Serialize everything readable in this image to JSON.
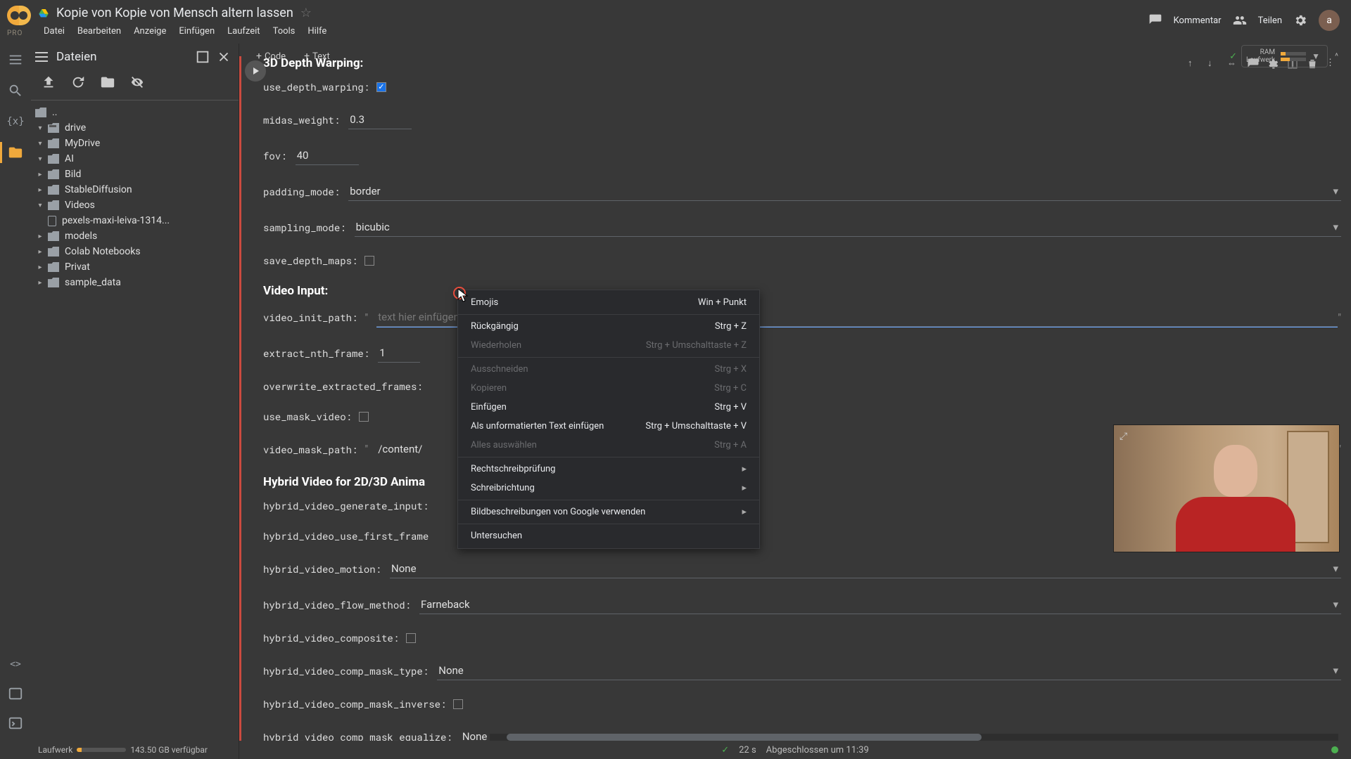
{
  "header": {
    "title": "Kopie von Kopie von Mensch altern lassen",
    "pro": "PRO",
    "menu": [
      "Datei",
      "Bearbeiten",
      "Anzeige",
      "Einfügen",
      "Laufzeit",
      "Tools",
      "Hilfe"
    ],
    "kommentar": "Kommentar",
    "teilen": "Teilen",
    "avatar": "a",
    "ram_l1": "RAM",
    "ram_l2": "Laufwerk"
  },
  "sub": {
    "code": "Code",
    "text": "Text"
  },
  "files": {
    "title": "Dateien",
    "tree": {
      "up": "..",
      "drive": "drive",
      "mydrive": "MyDrive",
      "ai": "AI",
      "bild": "Bild",
      "sd": "StableDiffusion",
      "videos": "Videos",
      "vidfile": "pexels-maxi-leiva-1314...",
      "models": "models",
      "colab": "Colab Notebooks",
      "privat": "Privat",
      "sample": "sample_data"
    },
    "disk_label": "Laufwerk",
    "disk_free": "143.50 GB verfügbar"
  },
  "form": {
    "sec1": "3D Depth Warping:",
    "use_depth_warping": "use_depth_warping:",
    "midas_weight_l": "midas_weight:",
    "midas_weight": "0.3",
    "fov_l": "fov:",
    "fov": "40",
    "padding_mode_l": "padding_mode:",
    "padding_mode": "border",
    "sampling_mode_l": "sampling_mode:",
    "sampling_mode": "bicubic",
    "save_depth_maps_l": "save_depth_maps:",
    "sec2": "Video Input:",
    "video_init_path_l": "video_init_path:",
    "video_init_path_ph": "text hier einfügen",
    "extract_nth_frame_l": "extract_nth_frame:",
    "extract_nth_frame": "1",
    "overwrite_extracted_frames_l": "overwrite_extracted_frames:",
    "use_mask_video_l": "use_mask_video:",
    "video_mask_path_l": "video_mask_path:",
    "video_mask_path": "/content/",
    "sec3": "Hybrid Video for 2D/3D Anima",
    "hybrid_video_generate_input_l": "hybrid_video_generate_input:",
    "hybrid_video_use_first_frame_l": "hybrid_video_use_first_frame",
    "hybrid_video_motion_l": "hybrid_video_motion:",
    "hybrid_video_motion": "None",
    "hybrid_video_flow_method_l": "hybrid_video_flow_method:",
    "hybrid_video_flow_method": "Farneback",
    "hybrid_video_composite_l": "hybrid_video_composite:",
    "hybrid_video_comp_mask_type_l": "hybrid_video_comp_mask_type:",
    "hybrid_video_comp_mask_type": "None",
    "hybrid_video_comp_mask_inverse_l": "hybrid_video_comp_mask_inverse:",
    "hybrid_video_comp_mask_equalize_l": "hybrid_video_comp_mask_equalize:",
    "hybrid_video_comp_mask_equalize": "None"
  },
  "ctx": {
    "emojis": "Emojis",
    "emojis_k": "Win + Punkt",
    "undo": "Rückgängig",
    "undo_k": "Strg + Z",
    "redo": "Wiederholen",
    "redo_k": "Strg + Umschalttaste + Z",
    "cut": "Ausschneiden",
    "cut_k": "Strg + X",
    "copy": "Kopieren",
    "copy_k": "Strg + C",
    "paste": "Einfügen",
    "paste_k": "Strg + V",
    "paste_plain": "Als unformatierten Text einfügen",
    "paste_plain_k": "Strg + Umschalttaste + V",
    "select_all": "Alles auswählen",
    "select_all_k": "Strg + A",
    "spell": "Rechtschreibprüfung",
    "dir": "Schreibrichtung",
    "img_desc": "Bildbeschreibungen von Google verwenden",
    "inspect": "Untersuchen"
  },
  "status": {
    "elapsed": "22 s",
    "done": "Abgeschlossen um 11:39"
  }
}
